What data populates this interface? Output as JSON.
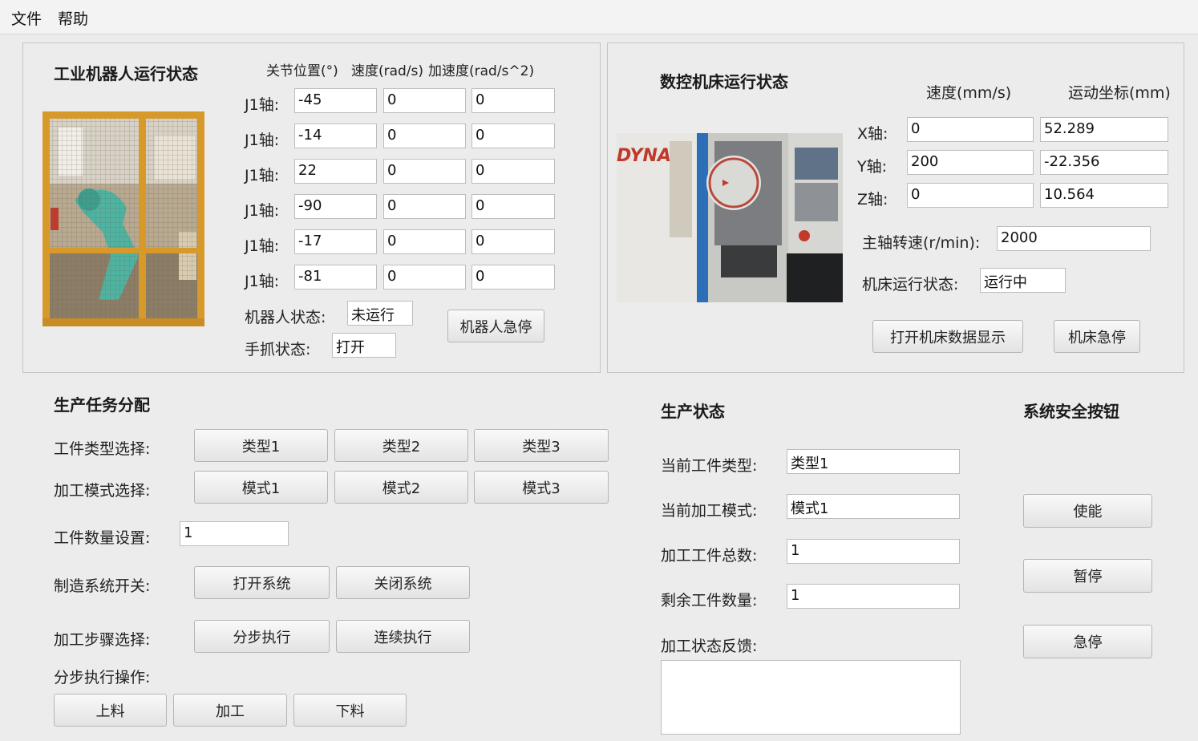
{
  "menu": {
    "file": "文件",
    "help": "帮助"
  },
  "robot": {
    "title": "工业机器人运行状态",
    "col_position": "关节位置(°)",
    "col_speed": "速度(rad/s)",
    "col_accel": "加速度(rad/s^2)",
    "joints": [
      {
        "label": "J1轴:",
        "position": "-45",
        "speed": "0",
        "accel": "0"
      },
      {
        "label": "J1轴:",
        "position": "-14",
        "speed": "0",
        "accel": "0"
      },
      {
        "label": "J1轴:",
        "position": "22",
        "speed": "0",
        "accel": "0"
      },
      {
        "label": "J1轴:",
        "position": "-90",
        "speed": "0",
        "accel": "0"
      },
      {
        "label": "J1轴:",
        "position": "-17",
        "speed": "0",
        "accel": "0"
      },
      {
        "label": "J1轴:",
        "position": "-81",
        "speed": "0",
        "accel": "0"
      }
    ],
    "status_label": "机器人状态:",
    "status_value": "未运行",
    "gripper_label": "手抓状态:",
    "gripper_value": "打开",
    "estop_button": "机器人急停"
  },
  "cnc": {
    "title": "数控机床运行状态",
    "col_speed": "速度(mm/s)",
    "col_coord": "运动坐标(mm)",
    "photo_brand": "DYNA",
    "axes": [
      {
        "label": "X轴:",
        "speed": "0",
        "coord": "52.289"
      },
      {
        "label": "Y轴:",
        "speed": "200",
        "coord": "-22.356"
      },
      {
        "label": "Z轴:",
        "speed": "0",
        "coord": "10.564"
      }
    ],
    "spindle_label": "主轴转速(r/min):",
    "spindle_value": "2000",
    "status_label": "机床运行状态:",
    "status_value": "运行中",
    "open_data_button": "打开机床数据显示",
    "estop_button": "机床急停"
  },
  "task": {
    "title": "生产任务分配",
    "type_label": "工件类型选择:",
    "types": [
      "类型1",
      "类型2",
      "类型3"
    ],
    "mode_label": "加工模式选择:",
    "modes": [
      "模式1",
      "模式2",
      "模式3"
    ],
    "count_label": "工件数量设置:",
    "count_value": "1",
    "switch_label": "制造系统开关:",
    "open_button": "打开系统",
    "close_button": "关闭系统",
    "step_label": "加工步骤选择:",
    "step_button": "分步执行",
    "continuous_button": "连续执行",
    "step_ops_label": "分步执行操作:",
    "load_button": "上料",
    "process_button": "加工",
    "unload_button": "下料"
  },
  "production": {
    "title": "生产状态",
    "current_type_label": "当前工件类型:",
    "current_type_value": "类型1",
    "current_mode_label": "当前加工模式:",
    "current_mode_value": "模式1",
    "total_label": "加工工件总数:",
    "total_value": "1",
    "remaining_label": "剩余工件数量:",
    "remaining_value": "1",
    "feedback_label": "加工状态反馈:"
  },
  "safety": {
    "title": "系统安全按钮",
    "enable_button": "使能",
    "pause_button": "暂停",
    "estop_button": "急停"
  }
}
